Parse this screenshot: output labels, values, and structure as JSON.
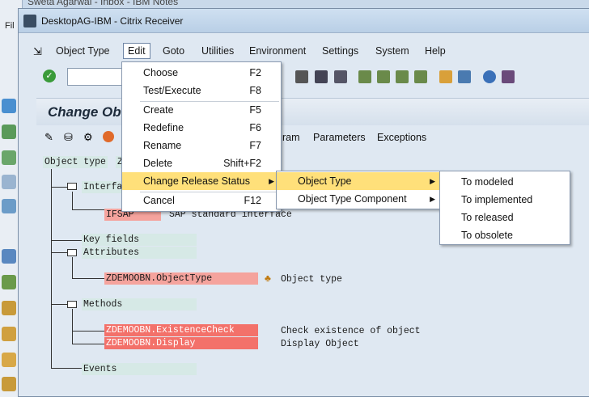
{
  "background": {
    "title_fragment": "Sweta Agarwal - Inbox - IBM Notes",
    "menu_fragment": "Fil"
  },
  "window": {
    "title": "DesktopAG-IBM - Citrix Receiver"
  },
  "menubar": [
    "Object Type",
    "Edit",
    "Goto",
    "Utilities",
    "Environment",
    "Settings",
    "System",
    "Help"
  ],
  "page_title": "Change Ob",
  "app_toolbar": [
    "gram",
    "Parameters",
    "Exceptions"
  ],
  "tree": {
    "object_type_label": "Object type",
    "object_type_value": "Z",
    "interface_label": "Interfa",
    "ifsap": "IFSAP",
    "ifsap_desc": "SAP standard interface",
    "key_fields": "Key fields",
    "attributes": "Attributes",
    "attr_item": "ZDEMOOBN.ObjectType",
    "attr_desc": "Object type",
    "methods": "Methods",
    "method1": "ZDEMOOBN.ExistenceCheck",
    "method1_desc": "Check existence of object",
    "method2": "ZDEMOOBN.Display",
    "method2_desc": "Display Object",
    "events": "Events"
  },
  "edit_menu": [
    {
      "label": "Choose",
      "shortcut": "F2"
    },
    {
      "label": "Test/Execute",
      "shortcut": "F8"
    },
    {
      "label": "Create",
      "shortcut": "F5"
    },
    {
      "label": "Redefine",
      "shortcut": "F6"
    },
    {
      "label": "Rename",
      "shortcut": "F7"
    },
    {
      "label": "Delete",
      "shortcut": "Shift+F2"
    },
    {
      "label": "Change Release Status",
      "shortcut": ""
    },
    {
      "label": "Cancel",
      "shortcut": "F12"
    }
  ],
  "release_submenu": [
    {
      "label": "Object Type"
    },
    {
      "label": "Object Type Component"
    }
  ],
  "status_submenu": [
    {
      "label": "To modeled"
    },
    {
      "label": "To implemented"
    },
    {
      "label": "To released"
    },
    {
      "label": "To obsolete"
    }
  ],
  "colors": {
    "highlight": "#ffe07a",
    "red_item": "#f3716a",
    "teal_item": "#d6e9e6"
  }
}
